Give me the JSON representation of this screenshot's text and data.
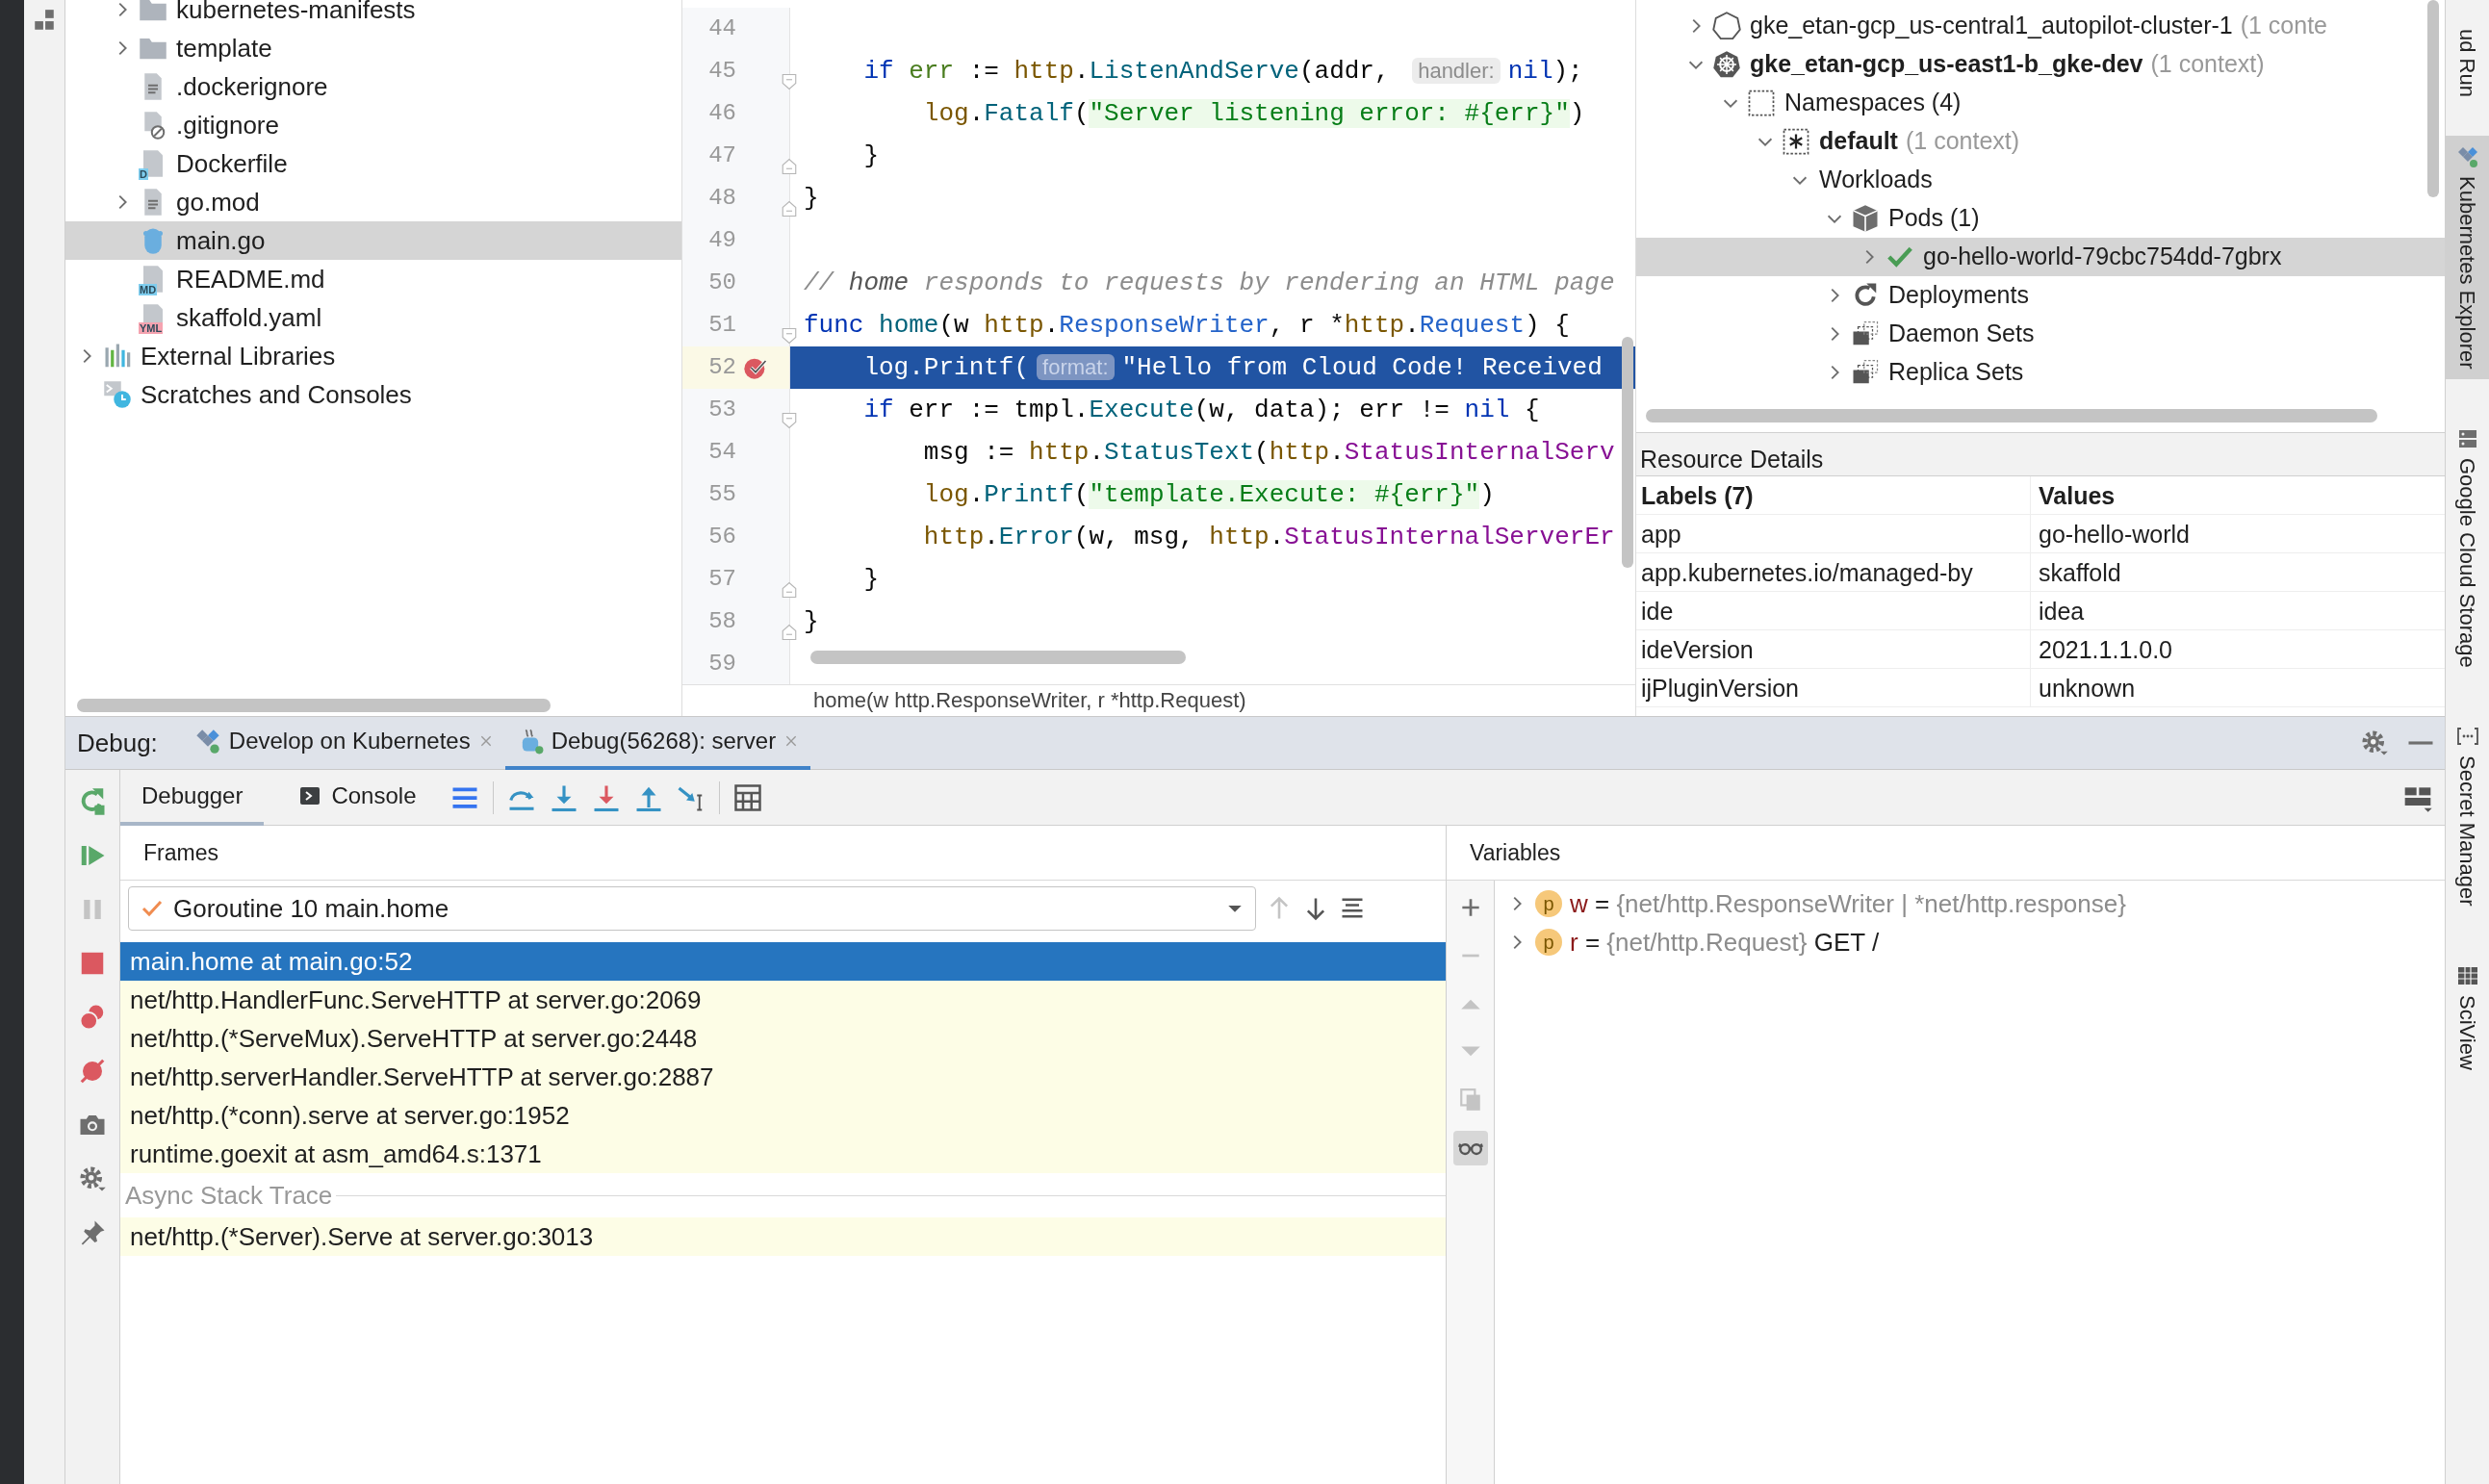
{
  "project": {
    "files": [
      {
        "label": "kubernetes-manifests",
        "kind": "folder",
        "expandable": true,
        "selected": false
      },
      {
        "label": "template",
        "kind": "folder",
        "expandable": true,
        "selected": false
      },
      {
        "label": ".dockerignore",
        "kind": "text",
        "expandable": false,
        "selected": false
      },
      {
        "label": ".gitignore",
        "kind": "ignore",
        "expandable": false,
        "selected": false
      },
      {
        "label": "Dockerfile",
        "kind": "typed",
        "badge": "D",
        "color": "#7fcdee",
        "expandable": false,
        "selected": false
      },
      {
        "label": "go.mod",
        "kind": "text",
        "expandable": true,
        "selected": false
      },
      {
        "label": "main.go",
        "kind": "go",
        "expandable": false,
        "selected": true
      },
      {
        "label": "README.md",
        "kind": "typed",
        "badge": "MD",
        "color": "#7fcdee",
        "expandable": false,
        "selected": false
      },
      {
        "label": "skaffold.yaml",
        "kind": "typed",
        "badge": "YML",
        "color": "#f5a3b0",
        "expandable": false,
        "selected": false
      }
    ],
    "roots": [
      {
        "label": "External Libraries",
        "kind": "libraries",
        "expandable": true,
        "selected": false
      },
      {
        "label": "Scratches and Consoles",
        "kind": "scratches",
        "expandable": false,
        "selected": false
      }
    ]
  },
  "editor": {
    "lines": [
      {
        "number": "44",
        "kind": "plain",
        "breakpoint": false,
        "current": false
      },
      {
        "number": "45",
        "kind": "fold-start",
        "breakpoint": false,
        "current": false,
        "tokens": [
          {
            "text": "    if",
            "kind": "keyword"
          },
          {
            "text": " err",
            "kind": "variable"
          },
          {
            "text": " := ",
            "kind": "plain"
          },
          {
            "text": "http",
            "kind": "package"
          },
          {
            "text": ".",
            "kind": "plain"
          },
          {
            "text": "ListenAndServe",
            "kind": "function"
          },
          {
            "text": "(addr, ",
            "kind": "plain"
          },
          {
            "text": "handler:",
            "kind": "hint"
          },
          {
            "text": "nil",
            "kind": "keyword"
          },
          {
            "text": ");",
            "kind": "plain"
          }
        ]
      },
      {
        "number": "46",
        "kind": "plain",
        "breakpoint": false,
        "current": false,
        "tokens": [
          {
            "text": "        log",
            "kind": "package"
          },
          {
            "text": ".",
            "kind": "plain"
          },
          {
            "text": "Fatalf",
            "kind": "function"
          },
          {
            "text": "(",
            "kind": "plain"
          },
          {
            "text": "\"Server listening error: #{err}\"",
            "kind": "string"
          },
          {
            "text": ")",
            "kind": "plain"
          }
        ]
      },
      {
        "number": "47",
        "kind": "fold-end",
        "breakpoint": false,
        "current": false,
        "tokens": [
          {
            "text": "    }",
            "kind": "plain"
          }
        ]
      },
      {
        "number": "48",
        "kind": "fold-end",
        "breakpoint": false,
        "current": false,
        "tokens": [
          {
            "text": "}",
            "kind": "plain"
          }
        ]
      },
      {
        "number": "49",
        "kind": "plain",
        "breakpoint": false,
        "current": false
      },
      {
        "number": "50",
        "kind": "plain",
        "breakpoint": false,
        "current": false,
        "tokens": [
          {
            "text": "// ",
            "kind": "comment"
          },
          {
            "text": "home",
            "kind": "comment-ref"
          },
          {
            "text": " responds to requests by rendering an HTML page",
            "kind": "comment"
          }
        ]
      },
      {
        "number": "51",
        "kind": "fold-start",
        "breakpoint": false,
        "current": false,
        "tokens": [
          {
            "text": "func",
            "kind": "keyword"
          },
          {
            "text": " home",
            "kind": "function"
          },
          {
            "text": "(w ",
            "kind": "plain"
          },
          {
            "text": "http",
            "kind": "package"
          },
          {
            "text": ".",
            "kind": "plain"
          },
          {
            "text": "ResponseWriter",
            "kind": "type"
          },
          {
            "text": ", r *",
            "kind": "plain"
          },
          {
            "text": "http",
            "kind": "package"
          },
          {
            "text": ".",
            "kind": "plain"
          },
          {
            "text": "Request",
            "kind": "type"
          },
          {
            "text": ") {",
            "kind": "plain"
          }
        ]
      },
      {
        "number": "52",
        "kind": "plain",
        "breakpoint": true,
        "current": true,
        "tokens": [
          {
            "text": "    log.Printf(",
            "kind": "plain"
          },
          {
            "text": "format:",
            "kind": "hint"
          },
          {
            "text": "\"Hello from Cloud Code! Received",
            "kind": "string"
          }
        ]
      },
      {
        "number": "53",
        "kind": "fold-start",
        "breakpoint": false,
        "current": false,
        "tokens": [
          {
            "text": "    if",
            "kind": "keyword"
          },
          {
            "text": " err := tmpl.",
            "kind": "plain"
          },
          {
            "text": "Execute",
            "kind": "function"
          },
          {
            "text": "(w, data); err != ",
            "kind": "plain"
          },
          {
            "text": "nil",
            "kind": "keyword"
          },
          {
            "text": " {",
            "kind": "plain"
          }
        ]
      },
      {
        "number": "54",
        "kind": "plain",
        "breakpoint": false,
        "current": false,
        "tokens": [
          {
            "text": "        msg := ",
            "kind": "plain"
          },
          {
            "text": "http",
            "kind": "package"
          },
          {
            "text": ".",
            "kind": "plain"
          },
          {
            "text": "StatusText",
            "kind": "function"
          },
          {
            "text": "(",
            "kind": "plain"
          },
          {
            "text": "http",
            "kind": "package"
          },
          {
            "text": ".",
            "kind": "plain"
          },
          {
            "text": "StatusInternalServ",
            "kind": "constant"
          }
        ]
      },
      {
        "number": "55",
        "kind": "plain",
        "breakpoint": false,
        "current": false,
        "tokens": [
          {
            "text": "        log",
            "kind": "package"
          },
          {
            "text": ".",
            "kind": "plain"
          },
          {
            "text": "Printf",
            "kind": "function"
          },
          {
            "text": "(",
            "kind": "plain"
          },
          {
            "text": "\"template.Execute: #{err}\"",
            "kind": "string"
          },
          {
            "text": ")",
            "kind": "plain"
          }
        ]
      },
      {
        "number": "56",
        "kind": "plain",
        "breakpoint": false,
        "current": false,
        "tokens": [
          {
            "text": "        http",
            "kind": "package"
          },
          {
            "text": ".",
            "kind": "plain"
          },
          {
            "text": "Error",
            "kind": "function"
          },
          {
            "text": "(w, msg, ",
            "kind": "plain"
          },
          {
            "text": "http",
            "kind": "package"
          },
          {
            "text": ".",
            "kind": "plain"
          },
          {
            "text": "StatusInternalServerEr",
            "kind": "constant"
          }
        ]
      },
      {
        "number": "57",
        "kind": "fold-end",
        "breakpoint": false,
        "current": false,
        "tokens": [
          {
            "text": "    }",
            "kind": "plain"
          }
        ]
      },
      {
        "number": "58",
        "kind": "fold-end",
        "breakpoint": false,
        "current": false,
        "tokens": [
          {
            "text": "}",
            "kind": "plain"
          }
        ]
      },
      {
        "number": "59",
        "kind": "plain",
        "breakpoint": false,
        "current": false
      }
    ],
    "breadcrumb": "home(w http.ResponseWriter, r *http.Request)"
  },
  "kubernetes": {
    "tree": [
      {
        "label": "gke_etan-gcp_us-central1_autopilot-cluster-1",
        "note": "(1 conte",
        "kind": "cluster-outline",
        "bold": false,
        "expanded": false,
        "selected": false
      },
      {
        "label": "gke_etan-gcp_us-east1-b_gke-dev",
        "note": "(1 context)",
        "kind": "cluster",
        "bold": true,
        "expanded": true,
        "selected": false,
        "children": [
          {
            "label": "Namespaces (4)",
            "kind": "namespaces",
            "bold": false,
            "expanded": true,
            "selected": false,
            "children": [
              {
                "label": "default",
                "note": "(1 context)",
                "kind": "namespace",
                "bold": true,
                "expanded": true,
                "selected": false,
                "children": [
                  {
                    "label": "Workloads",
                    "bold": false,
                    "expanded": true,
                    "selected": false,
                    "children": [
                      {
                        "label": "Pods (1)",
                        "kind": "pods",
                        "bold": false,
                        "expanded": true,
                        "selected": false,
                        "children": [
                          {
                            "label": "go-hello-world-79cbc754dd-7gbrx",
                            "kind": "ok",
                            "bold": false,
                            "expanded": false,
                            "selected": true
                          }
                        ]
                      },
                      {
                        "label": "Deployments",
                        "kind": "deployments",
                        "bold": false,
                        "expanded": false,
                        "selected": false
                      },
                      {
                        "label": "Daemon Sets",
                        "kind": "sets",
                        "bold": false,
                        "expanded": false,
                        "selected": false
                      },
                      {
                        "label": "Replica Sets",
                        "kind": "sets",
                        "bold": false,
                        "expanded": false,
                        "selected": false
                      }
                    ]
                  }
                ]
              }
            ]
          }
        ]
      }
    ],
    "resource_details": {
      "title": "Resource Details",
      "columns": [
        "Labels (7)",
        "Values"
      ],
      "rows": [
        [
          "app",
          "go-hello-world"
        ],
        [
          "app.kubernetes.io/managed-by",
          "skaffold"
        ],
        [
          "ide",
          "idea"
        ],
        [
          "ideVersion",
          "2021.1.1.0.0"
        ],
        [
          "ijPluginVersion",
          "unknown"
        ]
      ]
    }
  },
  "tool_windows": [
    {
      "label": "ud Run",
      "selected": false
    },
    {
      "label": "Kubernetes Explorer",
      "kind": "kubernetes",
      "selected": true
    },
    {
      "label": "Google Cloud Storage",
      "kind": "storage",
      "selected": false
    },
    {
      "label": "Secret Manager",
      "kind": "secret",
      "selected": false
    },
    {
      "label": "SciView",
      "kind": "sciview",
      "selected": false
    }
  ],
  "debug": {
    "label": "Debug:",
    "tabs": [
      {
        "label": "Develop on Kubernetes",
        "kind": "kubernetes",
        "selected": false
      },
      {
        "label": "Debug(56268): server",
        "kind": "debug",
        "selected": true
      }
    ],
    "subtabs": [
      {
        "label": "Debugger",
        "selected": true
      },
      {
        "label": "Console",
        "kind": "console",
        "selected": false
      }
    ],
    "actions": [
      {
        "kind": "rerun",
        "disabled": false
      },
      {
        "kind": "resume",
        "disabled": false
      },
      {
        "kind": "pause",
        "disabled": true
      },
      {
        "kind": "stop",
        "disabled": false
      },
      {
        "kind": "breakpoints",
        "disabled": false
      },
      {
        "kind": "mute",
        "disabled": false
      },
      {
        "kind": "camera",
        "disabled": false
      },
      {
        "kind": "settings",
        "disabled": false
      },
      {
        "kind": "pin",
        "disabled": false
      }
    ],
    "frames": {
      "title": "Frames",
      "thread": "Goroutine 10 main.home",
      "items": [
        {
          "label": "main.home at main.go:52",
          "selected": true
        },
        {
          "label": "net/http.HandlerFunc.ServeHTTP at server.go:2069",
          "selected": false
        },
        {
          "label": "net/http.(*ServeMux).ServeHTTP at server.go:2448",
          "selected": false
        },
        {
          "label": "net/http.serverHandler.ServeHTTP at server.go:2887",
          "selected": false
        },
        {
          "label": "net/http.(*conn).serve at server.go:1952",
          "selected": false
        },
        {
          "label": "runtime.goexit at asm_amd64.s:1371",
          "selected": false
        }
      ],
      "async_title": "Async Stack Trace",
      "async_items": [
        {
          "label": "net/http.(*Server).Serve at server.go:3013",
          "selected": false
        }
      ]
    },
    "variables": {
      "title": "Variables",
      "tools": [
        {
          "kind": "add",
          "disabled": false,
          "selected": false
        },
        {
          "kind": "remove",
          "disabled": true,
          "selected": false
        },
        {
          "kind": "up",
          "disabled": true,
          "selected": false
        },
        {
          "kind": "down",
          "disabled": true,
          "selected": false
        },
        {
          "kind": "copy",
          "disabled": true,
          "selected": false
        },
        {
          "kind": "watches",
          "disabled": false,
          "selected": true
        }
      ],
      "items": [
        {
          "badge": "p",
          "name": "w",
          "operator": "=",
          "type": "{net/http.ResponseWriter | *net/http.response}"
        },
        {
          "badge": "p",
          "name": "r",
          "operator": "=",
          "type": "{net/http.Request}",
          "value": "GET /"
        }
      ]
    }
  }
}
